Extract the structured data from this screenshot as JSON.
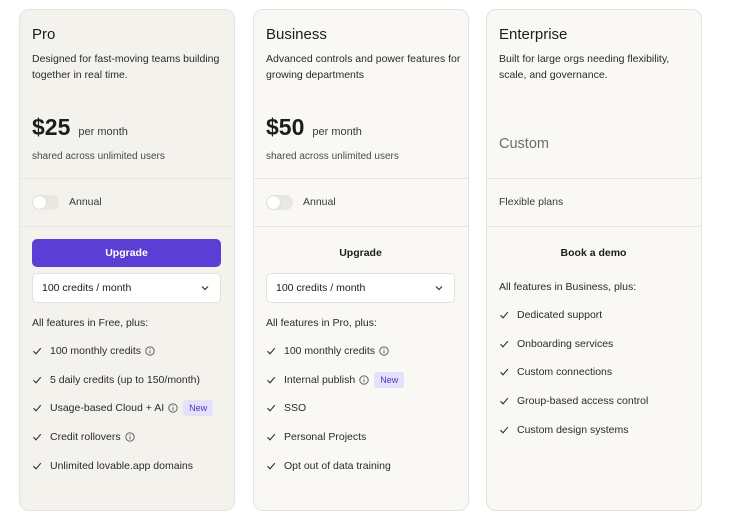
{
  "plans": {
    "pro": {
      "name": "Pro",
      "description": "Designed for fast-moving teams building together in real time.",
      "price": "$25",
      "period": "per month",
      "shared": "shared across unlimited users",
      "billing_label": "Annual",
      "billing_annual": false,
      "cta": "Upgrade",
      "credits_selected": "100 credits / month",
      "features_heading": "All features in Free, plus:",
      "features": [
        {
          "label": "100 monthly credits",
          "info": true
        },
        {
          "label": "5 daily credits (up to 150/month)",
          "info": false
        },
        {
          "label": "Usage-based Cloud + AI",
          "info": true,
          "badge": "New"
        },
        {
          "label": "Credit rollovers",
          "info": true
        },
        {
          "label": "Unlimited lovable.app domains",
          "info": false
        }
      ]
    },
    "business": {
      "name": "Business",
      "description": "Advanced controls and power features for growing departments",
      "price": "$50",
      "period": "per month",
      "shared": "shared across unlimited users",
      "billing_label": "Annual",
      "billing_annual": false,
      "cta": "Upgrade",
      "credits_selected": "100 credits / month",
      "features_heading": "All features in Pro, plus:",
      "features": [
        {
          "label": "100 monthly credits",
          "info": true
        },
        {
          "label": "Internal publish",
          "info": true,
          "badge": "New"
        },
        {
          "label": "SSO",
          "info": false
        },
        {
          "label": "Personal Projects",
          "info": false
        },
        {
          "label": "Opt out of data training",
          "info": false
        }
      ]
    },
    "enterprise": {
      "name": "Enterprise",
      "description": "Built for large orgs needing flexibility, scale, and governance.",
      "price": "Custom",
      "billing_label": "Flexible plans",
      "cta": "Book a demo",
      "features_heading": "All features in Business, plus:",
      "features": [
        {
          "label": "Dedicated support"
        },
        {
          "label": "Onboarding services"
        },
        {
          "label": "Custom connections"
        },
        {
          "label": "Group-based access control"
        },
        {
          "label": "Custom design systems"
        }
      ]
    }
  },
  "icons": {
    "check": "check-icon",
    "info": "info-icon",
    "chevron": "chevron-down-icon"
  },
  "colors": {
    "accent": "#5b3fd5",
    "badge_bg": "#e5e1fb",
    "badge_text": "#4b35c6"
  }
}
